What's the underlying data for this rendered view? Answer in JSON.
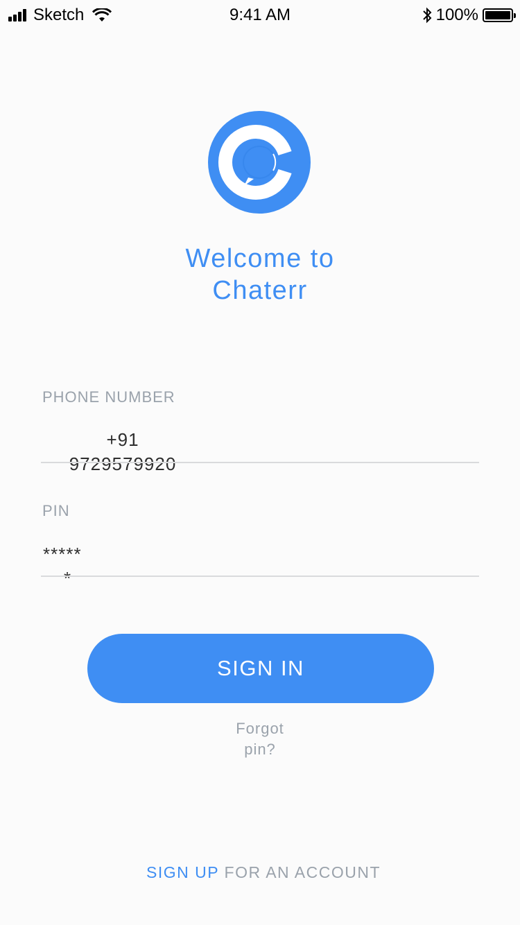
{
  "status_bar": {
    "carrier": "Sketch",
    "time": "9:41 AM",
    "battery_percent": "100%"
  },
  "welcome": {
    "line1": "Welcome to",
    "line2": "Chaterr"
  },
  "phone": {
    "label": "PHONE NUMBER",
    "code": "+91",
    "number": "9729579920"
  },
  "pin": {
    "label": "PIN",
    "masked_line1": "*****",
    "masked_line2": "*"
  },
  "signin": {
    "label": "SIGN IN"
  },
  "forgot": {
    "line1": "Forgot",
    "line2": "pin?"
  },
  "signup": {
    "link": "SIGN UP",
    "rest": " FOR AN ACCOUNT"
  },
  "colors": {
    "accent": "#3f8ef3",
    "muted": "#9aa2ab",
    "background": "#fbfbfb"
  }
}
